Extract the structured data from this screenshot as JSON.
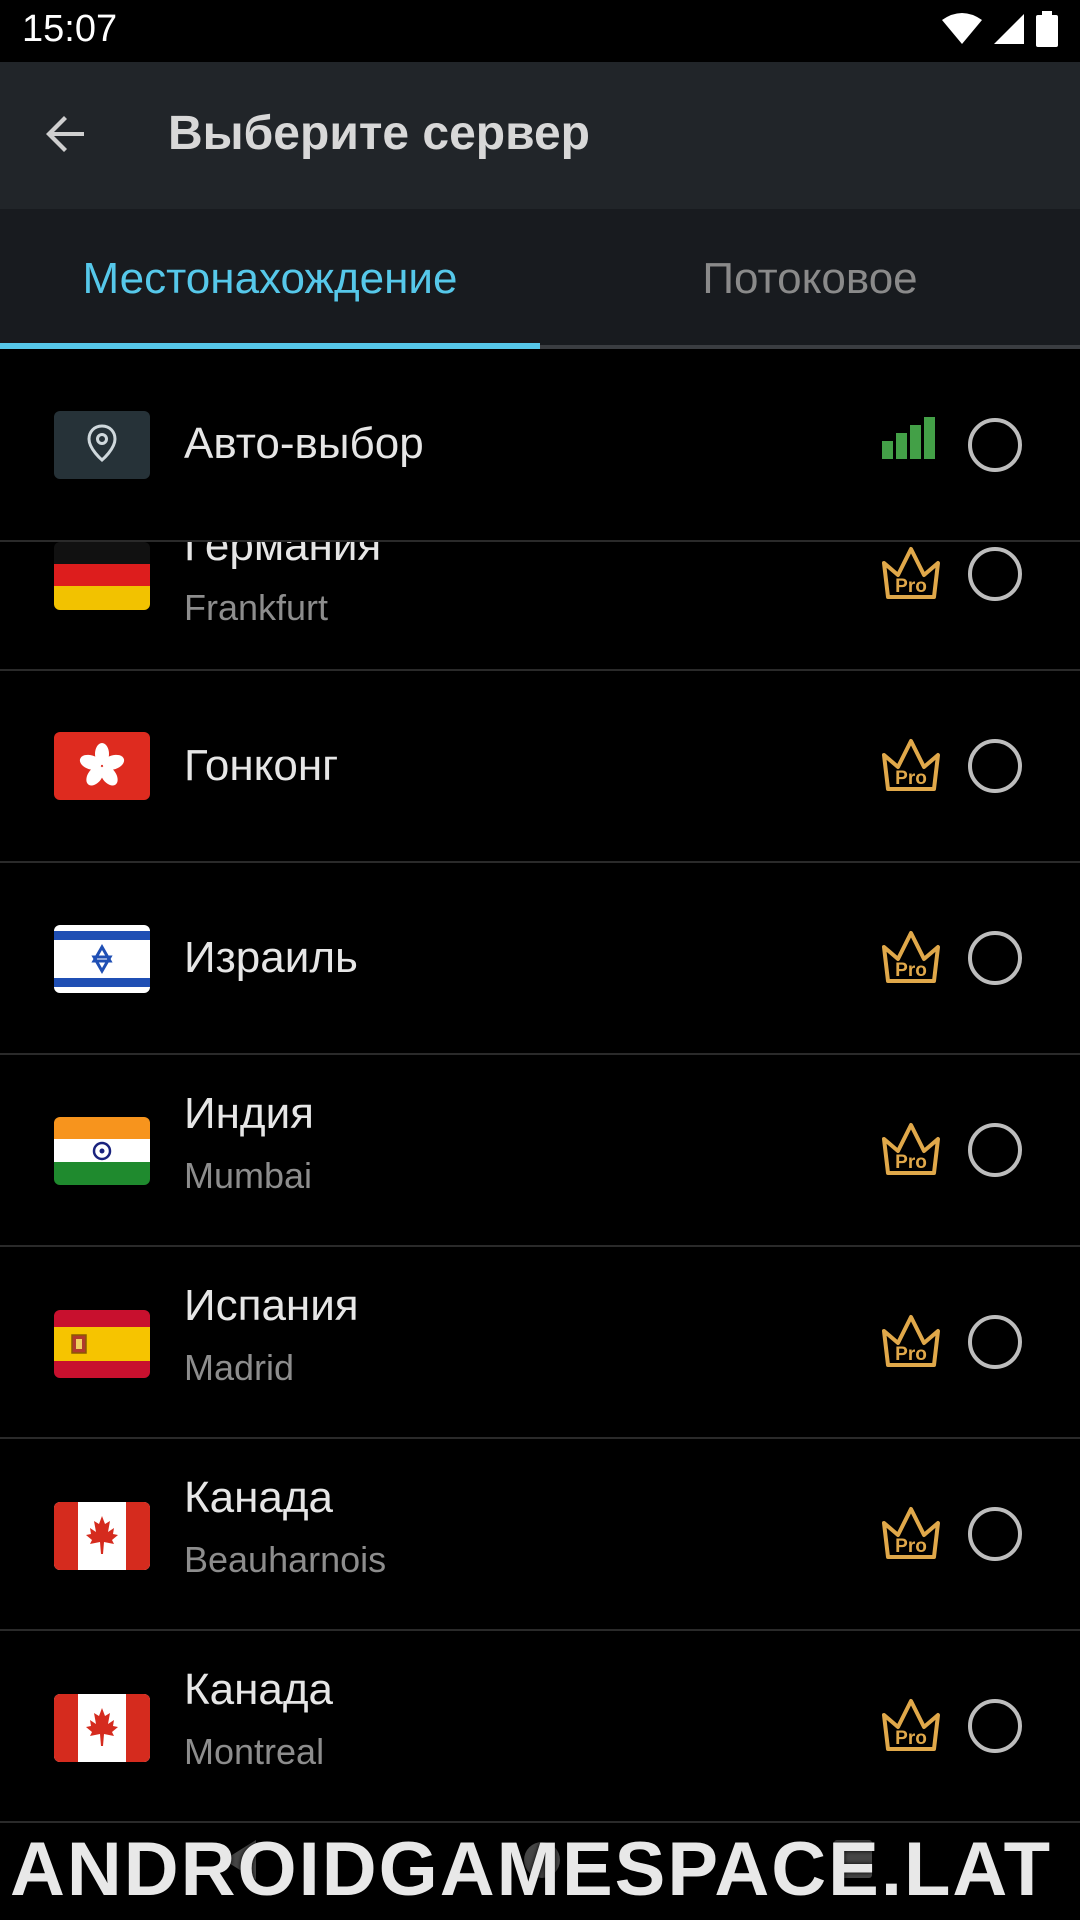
{
  "status_bar": {
    "time": "15:07",
    "icons": [
      "wifi-icon",
      "signal-icon",
      "battery-icon"
    ]
  },
  "header": {
    "title": "Выберите сервер",
    "back_icon": "arrow-back-icon"
  },
  "tabs": [
    {
      "label": "Местонахождение",
      "active": true
    },
    {
      "label": "Потоковое",
      "active": false
    }
  ],
  "auto_select": {
    "label": "Авто-выбор",
    "icon": "location-pin-icon",
    "signal_icon": "signal-bars-icon",
    "signal_color": "#43a047"
  },
  "servers": [
    {
      "country": "Германия",
      "city": "Frankfurt",
      "flag": "germany-flag",
      "badge": "Pro"
    },
    {
      "country": "Гонконг",
      "city": "",
      "flag": "hong-kong-flag",
      "badge": "Pro"
    },
    {
      "country": "Израиль",
      "city": "",
      "flag": "israel-flag",
      "badge": "Pro"
    },
    {
      "country": "Индия",
      "city": "Mumbai",
      "flag": "india-flag",
      "badge": "Pro"
    },
    {
      "country": "Испания",
      "city": "Madrid",
      "flag": "spain-flag",
      "badge": "Pro"
    },
    {
      "country": "Канада",
      "city": "Beauharnois",
      "flag": "canada-flag",
      "badge": "Pro"
    },
    {
      "country": "Канада",
      "city": "Montreal",
      "flag": "canada-flag",
      "badge": "Pro"
    }
  ],
  "watermark": "ANDROIDGAMESPACE.LAT",
  "colors": {
    "accent": "#56c8ea",
    "pro_gold": "#e0a84a",
    "app_bar": "#212529",
    "background": "#000000"
  }
}
